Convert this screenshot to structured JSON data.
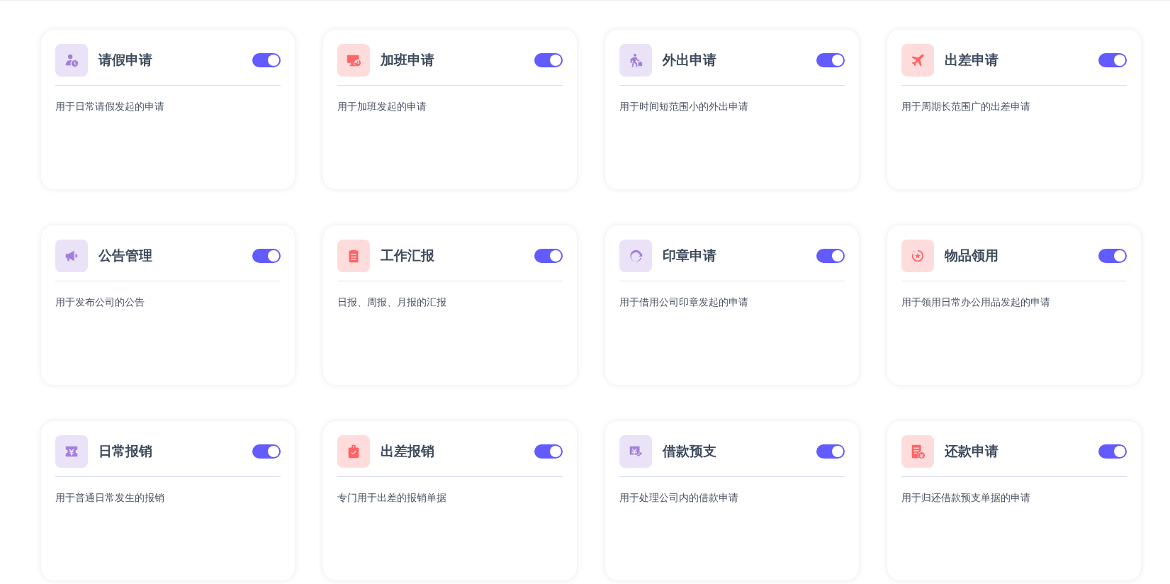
{
  "cards": [
    {
      "title": "请假申请",
      "description": "用于日常请假发起的申请",
      "on": true,
      "color": "#a27fdc"
    },
    {
      "title": "加班申请",
      "description": "用于加班发起的申请",
      "on": true,
      "color": "#ff6466"
    },
    {
      "title": "外出申请",
      "description": "用于时间短范围小的外出申请",
      "on": true,
      "color": "#a27fdc"
    },
    {
      "title": "出差申请",
      "description": "用于周期长范围广的出差申请",
      "on": true,
      "color": "#ff6466"
    },
    {
      "title": "公告管理",
      "description": "用于发布公司的公告",
      "on": true,
      "color": "#a27fdc"
    },
    {
      "title": "工作汇报",
      "description": "日报、周报、月报的汇报",
      "on": true,
      "color": "#ff6466"
    },
    {
      "title": "印章申请",
      "description": "用于借用公司印章发起的申请",
      "on": true,
      "color": "#a27fdc"
    },
    {
      "title": "物品领用",
      "description": "用于领用日常办公用品发起的申请",
      "on": true,
      "color": "#ff6466"
    },
    {
      "title": "日常报销",
      "description": "用于普通日常发生的报销",
      "on": true,
      "color": "#a27fdc"
    },
    {
      "title": "出差报销",
      "description": "专门用于出差的报销单据",
      "on": true,
      "color": "#ff6466"
    },
    {
      "title": "借款预支",
      "description": "用于处理公司内的借款申请",
      "on": true,
      "color": "#a27fdc"
    },
    {
      "title": "还款申请",
      "description": "用于归还借款预支单据的申请",
      "on": true,
      "color": "#ff6466"
    }
  ]
}
